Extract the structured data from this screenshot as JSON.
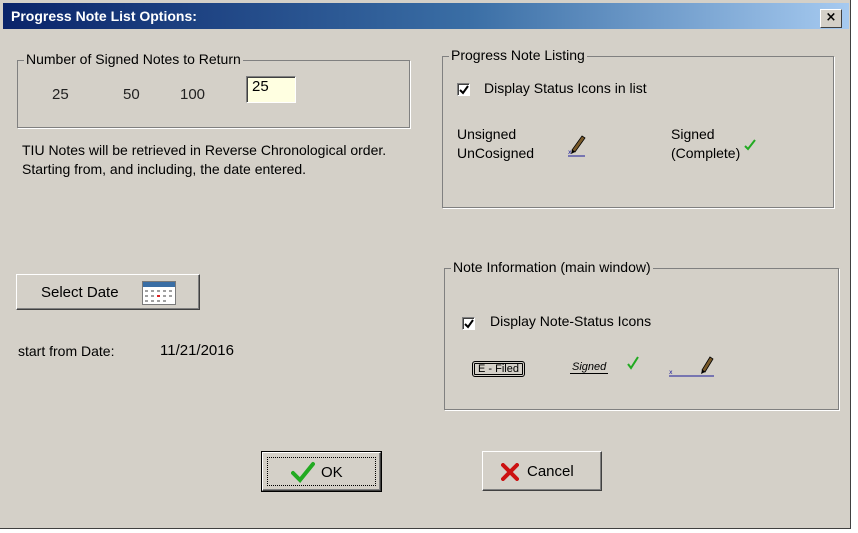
{
  "window": {
    "title": "Progress Note List Options:",
    "close_label": "×"
  },
  "signed_notes": {
    "title": "Number of Signed Notes to Return",
    "options": [
      "25",
      "50",
      "100"
    ],
    "value": "25"
  },
  "info_text": "TIU Notes will be retrieved in Reverse Chronological order. Starting from, and including, the date entered.",
  "select_date": {
    "label": "Select Date",
    "icon": "calendar-icon"
  },
  "start_date": {
    "label": "start from Date:",
    "value": "11/21/2016"
  },
  "listing": {
    "title": "Progress Note Listing",
    "checkbox_label": "Display Status Icons in list",
    "checked": true,
    "unsigned_line1": "Unsigned",
    "unsigned_line2": "UnCosigned",
    "signed_line1": "Signed",
    "signed_line2": "(Complete)"
  },
  "note_info": {
    "title": "Note Information (main window)",
    "checkbox_label": "Display Note-Status Icons",
    "checked": true,
    "filed_badge": "E - Filed",
    "signed_badge": "Signed"
  },
  "buttons": {
    "ok": "OK",
    "cancel": "Cancel"
  },
  "colors": {
    "title_bar": "#0a246a",
    "check_green": "#22aa22",
    "cancel_red": "#cc1111",
    "face": "#d4d0c8"
  }
}
